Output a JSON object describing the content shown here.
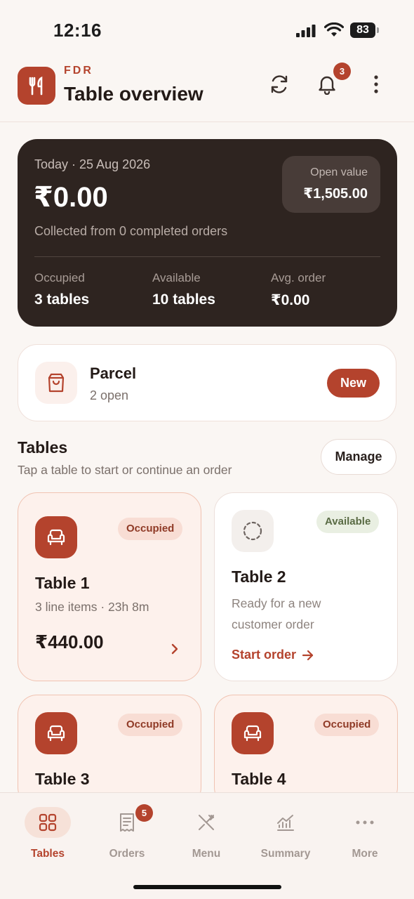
{
  "status_bar": {
    "time": "12:16",
    "battery": "83"
  },
  "header": {
    "brand": "FDR",
    "title": "Table overview",
    "notification_count": "3"
  },
  "summary": {
    "date": "Today · 25 Aug 2026",
    "amount": "₹0.00",
    "collected": "Collected from 0 completed orders",
    "open_value_label": "Open value",
    "open_value": "₹1,505.00",
    "stats": [
      {
        "label": "Occupied",
        "value": "3 tables"
      },
      {
        "label": "Available",
        "value": "10 tables"
      },
      {
        "label": "Avg. order",
        "value": "₹0.00"
      }
    ]
  },
  "parcel": {
    "name": "Parcel",
    "open": "2 open",
    "new_label": "New"
  },
  "tables_section": {
    "title": "Tables",
    "subtitle": "Tap a table to start or continue an order",
    "manage_label": "Manage",
    "tables": [
      {
        "name": "Table 1",
        "status": "Occupied",
        "meta": "3 line items · 23h 8m",
        "amount": "₹440.00"
      },
      {
        "name": "Table 2",
        "status": "Available",
        "description": "Ready for a new customer order",
        "action": "Start order"
      },
      {
        "name": "Table 3",
        "status": "Occupied"
      },
      {
        "name": "Table 4",
        "status": "Occupied"
      }
    ]
  },
  "bottom_nav": {
    "items": [
      {
        "label": "Tables",
        "icon": "grid-icon",
        "active": true
      },
      {
        "label": "Orders",
        "icon": "receipt-icon",
        "badge": "5"
      },
      {
        "label": "Menu",
        "icon": "utensils-crossed-icon"
      },
      {
        "label": "Summary",
        "icon": "chart-icon"
      },
      {
        "label": "More",
        "icon": "more-horizontal-icon"
      }
    ]
  },
  "colors": {
    "accent": "#b4432d",
    "dark_card": "#2e2420",
    "background": "#faf6f3"
  }
}
